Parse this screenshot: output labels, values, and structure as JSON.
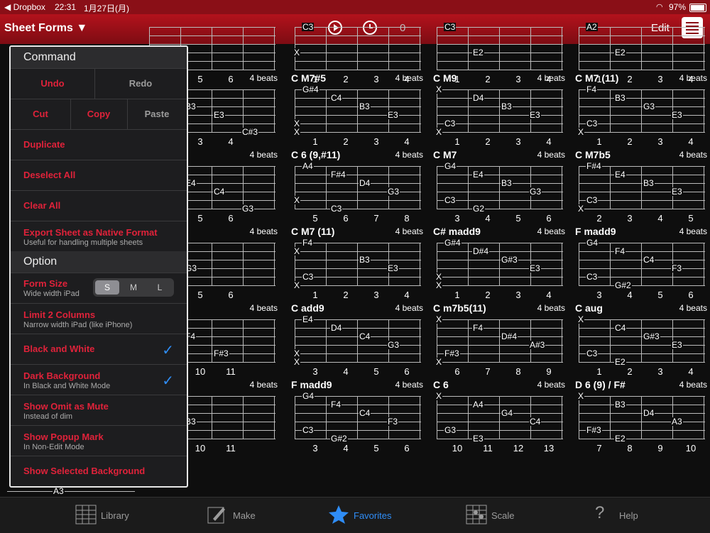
{
  "status": {
    "carrier": "◀ Dropbox",
    "time": "22:31",
    "date": "1月27日(月)",
    "battery": "97%"
  },
  "nav": {
    "title": "Sheet Forms",
    "counter": "0",
    "edit": "Edit"
  },
  "menu": {
    "command_header": "Command",
    "undo": "Undo",
    "redo": "Redo",
    "cut": "Cut",
    "copy": "Copy",
    "paste": "Paste",
    "duplicate": "Duplicate",
    "deselect_all": "Deselect All",
    "clear_all": "Clear All",
    "export": "Export Sheet as Native Format",
    "export_sub": "Useful for handling multiple sheets",
    "option_header": "Option",
    "form_size": "Form Size",
    "form_size_sub": "Wide width iPad",
    "size_s": "S",
    "size_m": "M",
    "size_l": "L",
    "limit2": "Limit 2 Columns",
    "limit2_sub": "Narrow width iPad (like iPhone)",
    "bw": "Black and White",
    "dark": "Dark Background",
    "dark_sub": "In Black and White Mode",
    "omit": "Show Omit as Mute",
    "omit_sub": "Instead of dim",
    "popup": "Show Popup Mark",
    "popup_sub": "In Non-Edit Mode",
    "selected_bg": "Show Selected Background"
  },
  "tabs": [
    {
      "label": "Library",
      "icon": "library-icon"
    },
    {
      "label": "Make",
      "icon": "pencil-icon"
    },
    {
      "label": "Favorites",
      "icon": "star-icon"
    },
    {
      "label": "Scale",
      "icon": "scale-icon"
    },
    {
      "label": "Help",
      "icon": "question-icon"
    }
  ],
  "cards": [
    {
      "name": "",
      "beats": "",
      "frets": [
        "4",
        "5",
        "6",
        ""
      ],
      "notes": []
    },
    {
      "name": "",
      "beats": "",
      "frets": [
        "1",
        "2",
        "3",
        "4"
      ],
      "notes": [
        "C3",
        "X"
      ]
    },
    {
      "name": "",
      "beats": "",
      "frets": [
        "1",
        "2",
        "3",
        "4"
      ],
      "notes": [
        "C3",
        "E2"
      ]
    },
    {
      "name": "",
      "beats": "",
      "frets": [
        "1",
        "2",
        "3",
        "4"
      ],
      "notes": [
        "A2",
        "E2"
      ]
    },
    {
      "name": "5",
      "beats": "4 beats",
      "frets": [
        "2",
        "3",
        "4",
        ""
      ],
      "notes": [
        "F#4",
        "B3",
        "E3",
        "C#3"
      ]
    },
    {
      "name": "C M7#5",
      "beats": "4 beats",
      "frets": [
        "1",
        "2",
        "3",
        "4"
      ],
      "notes": [
        "G#4",
        "C4",
        "B3",
        "E3",
        "X",
        "X"
      ]
    },
    {
      "name": "C M9",
      "beats": "4 beats",
      "frets": [
        "1",
        "2",
        "3",
        "4"
      ],
      "notes": [
        "X",
        "D4",
        "B3",
        "E3",
        "C3",
        "X"
      ]
    },
    {
      "name": "C M7 (11)",
      "beats": "4 beats",
      "frets": [
        "1",
        "2",
        "3",
        "4"
      ],
      "notes": [
        "F4",
        "B3",
        "G3",
        "E3",
        "C3",
        "X"
      ]
    },
    {
      "name": "",
      "beats": "4 beats",
      "frets": [
        "4",
        "5",
        "6",
        ""
      ],
      "notes": [
        "A4",
        "E4",
        "C4",
        "G3"
      ]
    },
    {
      "name": "C 6 (9,#11)",
      "beats": "4 beats",
      "frets": [
        "5",
        "6",
        "7",
        "8"
      ],
      "notes": [
        "A4",
        "F#4",
        "D4",
        "G3",
        "X",
        "C3"
      ]
    },
    {
      "name": "C M7",
      "beats": "4 beats",
      "frets": [
        "3",
        "4",
        "5",
        "6"
      ],
      "notes": [
        "G4",
        "E4",
        "B3",
        "G3",
        "C3",
        "G2"
      ]
    },
    {
      "name": "C M7b5",
      "beats": "4 beats",
      "frets": [
        "2",
        "3",
        "4",
        "5"
      ],
      "notes": [
        "F#4",
        "E4",
        "B3",
        "E3",
        "C3",
        "X"
      ]
    },
    {
      "name": "",
      "beats": "4 beats",
      "frets": [
        "4",
        "5",
        "6",
        ""
      ],
      "notes": [
        "B3",
        "G3"
      ]
    },
    {
      "name": "C M7 (11)",
      "beats": "4 beats",
      "frets": [
        "1",
        "2",
        "3",
        "4"
      ],
      "notes": [
        "F4",
        "X",
        "B3",
        "E3",
        "C3",
        "X"
      ]
    },
    {
      "name": "C# madd9",
      "beats": "4 beats",
      "frets": [
        "1",
        "2",
        "3",
        "4"
      ],
      "notes": [
        "G#4",
        "D#4",
        "G#3",
        "E3",
        "X",
        "X"
      ]
    },
    {
      "name": "F madd9",
      "beats": "4 beats",
      "frets": [
        "3",
        "4",
        "5",
        "6"
      ],
      "notes": [
        "G4",
        "F4",
        "C4",
        "F3",
        "C3",
        "G#2"
      ]
    },
    {
      "name": "(9,11)",
      "beats": "4 beats",
      "frets": [
        "9",
        "10",
        "11",
        ""
      ],
      "notes": [
        "G#4",
        "F4",
        "F#3"
      ]
    },
    {
      "name": "C add9",
      "beats": "4 beats",
      "frets": [
        "3",
        "4",
        "5",
        "6"
      ],
      "notes": [
        "E4",
        "D4",
        "C4",
        "G3",
        "X",
        "X"
      ]
    },
    {
      "name": "C m7b5(11)",
      "beats": "4 beats",
      "frets": [
        "6",
        "7",
        "8",
        "9"
      ],
      "notes": [
        "X",
        "F4",
        "D#4",
        "A#3",
        "F#3",
        "X"
      ]
    },
    {
      "name": "C aug",
      "beats": "4 beats",
      "frets": [
        "1",
        "2",
        "3",
        "4"
      ],
      "notes": [
        "X",
        "C4",
        "G#3",
        "E3",
        "C3",
        "E2"
      ]
    },
    {
      "name": "",
      "beats": "4 beats",
      "frets": [
        "9",
        "10",
        "11",
        ""
      ],
      "notes": [
        "E4",
        "B3"
      ]
    },
    {
      "name": "F madd9",
      "beats": "4 beats",
      "frets": [
        "3",
        "4",
        "5",
        "6"
      ],
      "notes": [
        "G4",
        "F4",
        "C4",
        "F3",
        "C3",
        "G#2"
      ]
    },
    {
      "name": "C 6",
      "beats": "4 beats",
      "frets": [
        "10",
        "11",
        "12",
        "13"
      ],
      "notes": [
        "X",
        "A4",
        "G4",
        "C4",
        "G3",
        "E3"
      ]
    },
    {
      "name": "D 6 (9) / F#",
      "beats": "4 beats",
      "frets": [
        "7",
        "8",
        "9",
        "10"
      ],
      "notes": [
        "X",
        "B3",
        "D4",
        "A3",
        "F#3",
        "E2"
      ]
    }
  ],
  "bottom_note": "A3"
}
